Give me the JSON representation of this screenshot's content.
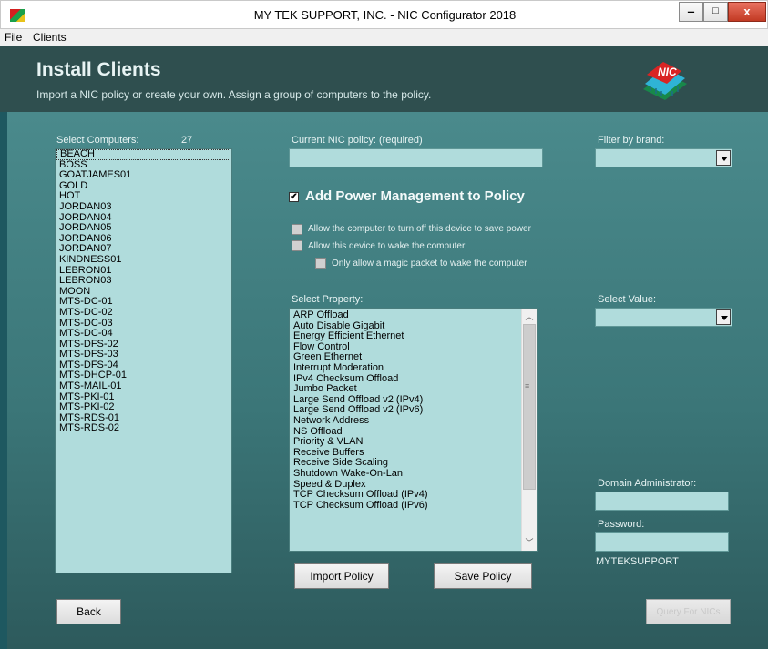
{
  "window": {
    "title": "MY TEK SUPPORT, INC. - NIC Configurator 2018",
    "minimize": "‒",
    "maximize": "□",
    "close": "x"
  },
  "menu": [
    "File",
    "Clients"
  ],
  "header": {
    "title": "Install Clients",
    "subtitle": "Import a NIC policy or create your own.  Assign a group of computers to the policy.",
    "logo_text": "NIC"
  },
  "computers": {
    "label": "Select Computers:",
    "count": "27",
    "items": [
      "BEACH",
      "BOSS",
      "GOATJAMES01",
      "GOLD",
      "HOT",
      "JORDAN03",
      "JORDAN04",
      "JORDAN05",
      "JORDAN06",
      "JORDAN07",
      "KINDNESS01",
      "LEBRON01",
      "LEBRON03",
      "MOON",
      "MTS-DC-01",
      "MTS-DC-02",
      "MTS-DC-03",
      "MTS-DC-04",
      "MTS-DFS-02",
      "MTS-DFS-03",
      "MTS-DFS-04",
      "MTS-DHCP-01",
      "MTS-MAIL-01",
      "MTS-PKI-01",
      "MTS-PKI-02",
      "MTS-RDS-01",
      "MTS-RDS-02"
    ],
    "selected": "BEACH"
  },
  "policy": {
    "label": "Current NIC policy: (required)",
    "value": ""
  },
  "brand_filter": {
    "label": "Filter by brand:",
    "value": ""
  },
  "power_mgmt": {
    "label": "Add Power Management to Policy",
    "checked": true,
    "options": [
      "Allow the computer to turn off this device to save power",
      "Allow this device to wake the computer",
      "Only allow a magic packet to wake the computer"
    ]
  },
  "property": {
    "label": "Select Property:",
    "items": [
      "ARP Offload",
      "Auto Disable Gigabit",
      "Energy Efficient Ethernet",
      "Flow Control",
      "Green Ethernet",
      "Interrupt Moderation",
      "IPv4 Checksum Offload",
      "Jumbo Packet",
      "Large Send Offload v2 (IPv4)",
      "Large Send Offload v2 (IPv6)",
      "Network Address",
      "NS Offload",
      "Priority & VLAN",
      "Receive Buffers",
      "Receive Side Scaling",
      "Shutdown Wake-On-Lan",
      "Speed & Duplex",
      "TCP Checksum Offload (IPv4)",
      "TCP Checksum Offload (IPv6)"
    ]
  },
  "value_select": {
    "label": "Select Value:",
    "value": ""
  },
  "credentials": {
    "admin_label": "Domain Administrator:",
    "admin_value": "",
    "password_label": "Password:",
    "password_value": "",
    "domain": "MYTEKSUPPORT"
  },
  "buttons": {
    "import": "Import Policy",
    "save": "Save Policy",
    "back": "Back",
    "query": "Query For NICs"
  },
  "colors": {
    "header_bg": "#2f4f4f",
    "panel_bg": "#3b7678",
    "field_bg": "#b0dcdc"
  }
}
